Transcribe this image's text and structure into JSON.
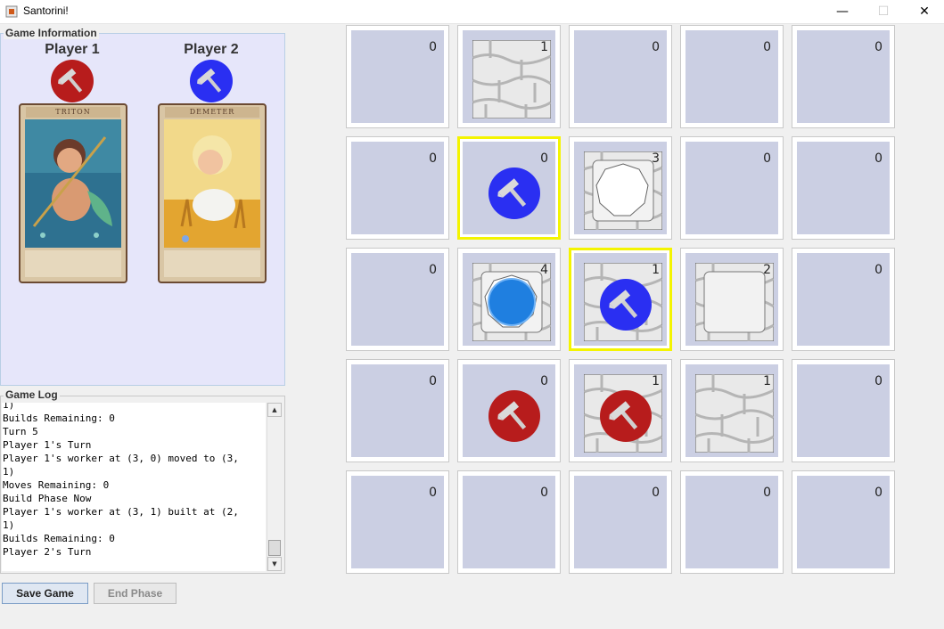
{
  "window": {
    "title": "Santorini!",
    "controls": [
      "—",
      "☐",
      "✕"
    ]
  },
  "info": {
    "title": "Game Information",
    "player1": {
      "name": "Player 1",
      "color": "#b71c1c",
      "god": "TRITON"
    },
    "player2": {
      "name": "Player 2",
      "color": "#2a2ff2",
      "god": "DEMETER"
    }
  },
  "log": {
    "title": "Game Log",
    "lines": [
      "1)",
      "Builds Remaining: 0",
      "Turn 5",
      "Player 1's Turn",
      "Player 1's worker at (3, 0) moved to (3,",
      "1)",
      "Moves Remaining: 0",
      "Build Phase Now",
      "Player 1's worker at (3, 1) built at (2,",
      "1)",
      "Builds Remaining: 0",
      "Player 2's Turn"
    ]
  },
  "buttons": {
    "save": "Save Game",
    "end_phase": "End Phase"
  },
  "board": {
    "cells": [
      {
        "row": 0,
        "col": 0,
        "level": "0",
        "worker": null,
        "selected": false
      },
      {
        "row": 0,
        "col": 1,
        "level": "1",
        "worker": null,
        "selected": false
      },
      {
        "row": 0,
        "col": 2,
        "level": "0",
        "worker": null,
        "selected": false
      },
      {
        "row": 0,
        "col": 3,
        "level": "0",
        "worker": null,
        "selected": false
      },
      {
        "row": 0,
        "col": 4,
        "level": "0",
        "worker": null,
        "selected": false
      },
      {
        "row": 1,
        "col": 0,
        "level": "0",
        "worker": null,
        "selected": false
      },
      {
        "row": 1,
        "col": 1,
        "level": "0",
        "worker": "blue",
        "selected": true
      },
      {
        "row": 1,
        "col": 2,
        "level": "3",
        "worker": null,
        "selected": false
      },
      {
        "row": 1,
        "col": 3,
        "level": "0",
        "worker": null,
        "selected": false
      },
      {
        "row": 1,
        "col": 4,
        "level": "0",
        "worker": null,
        "selected": false
      },
      {
        "row": 2,
        "col": 0,
        "level": "0",
        "worker": null,
        "selected": false
      },
      {
        "row": 2,
        "col": 1,
        "level": "4",
        "worker": null,
        "selected": false
      },
      {
        "row": 2,
        "col": 2,
        "level": "1",
        "worker": "blue",
        "selected": true
      },
      {
        "row": 2,
        "col": 3,
        "level": "2",
        "worker": null,
        "selected": false
      },
      {
        "row": 2,
        "col": 4,
        "level": "0",
        "worker": null,
        "selected": false
      },
      {
        "row": 3,
        "col": 0,
        "level": "0",
        "worker": null,
        "selected": false
      },
      {
        "row": 3,
        "col": 1,
        "level": "0",
        "worker": "red",
        "selected": false
      },
      {
        "row": 3,
        "col": 2,
        "level": "1",
        "worker": "red",
        "selected": false
      },
      {
        "row": 3,
        "col": 3,
        "level": "1",
        "worker": null,
        "selected": false
      },
      {
        "row": 3,
        "col": 4,
        "level": "0",
        "worker": null,
        "selected": false
      },
      {
        "row": 4,
        "col": 0,
        "level": "0",
        "worker": null,
        "selected": false
      },
      {
        "row": 4,
        "col": 1,
        "level": "0",
        "worker": null,
        "selected": false
      },
      {
        "row": 4,
        "col": 2,
        "level": "0",
        "worker": null,
        "selected": false
      },
      {
        "row": 4,
        "col": 3,
        "level": "0",
        "worker": null,
        "selected": false
      },
      {
        "row": 4,
        "col": 4,
        "level": "0",
        "worker": null,
        "selected": false
      }
    ]
  },
  "colors": {
    "red_worker": "#b71c1c",
    "blue_worker": "#2a2ff2",
    "selection": "#f4f400",
    "empty_cell": "#cbcfe3"
  }
}
